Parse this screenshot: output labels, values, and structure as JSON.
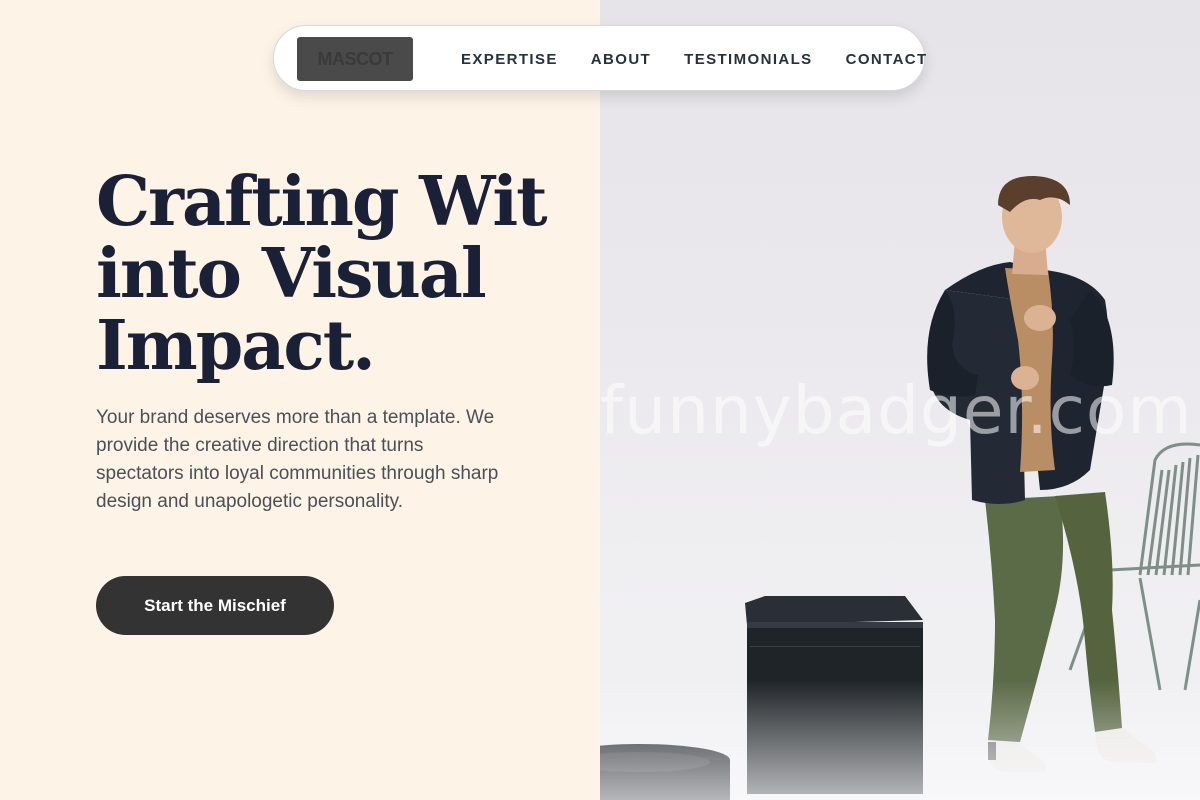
{
  "nav": {
    "logo_text": "MASCOT",
    "links": [
      {
        "label": "EXPERTISE"
      },
      {
        "label": "ABOUT"
      },
      {
        "label": "TESTIMONIALS"
      },
      {
        "label": "CONTACT"
      }
    ]
  },
  "hero": {
    "title_lines": [
      "Crafting Wit",
      "into Visual",
      "Impact."
    ],
    "description": "Your brand deserves more than a template. We provide the creative direction that turns spectators into loyal communities through sharp design and unapologetic personality.",
    "cta_label": "Start the Mischief"
  },
  "photo": {
    "watermark": "funnybadger.com"
  },
  "colors": {
    "left_background": "#fdf4e7",
    "heading": "#1a2035",
    "body_text": "#4b4f58",
    "button": "#333333",
    "nav_text": "#27303d"
  }
}
